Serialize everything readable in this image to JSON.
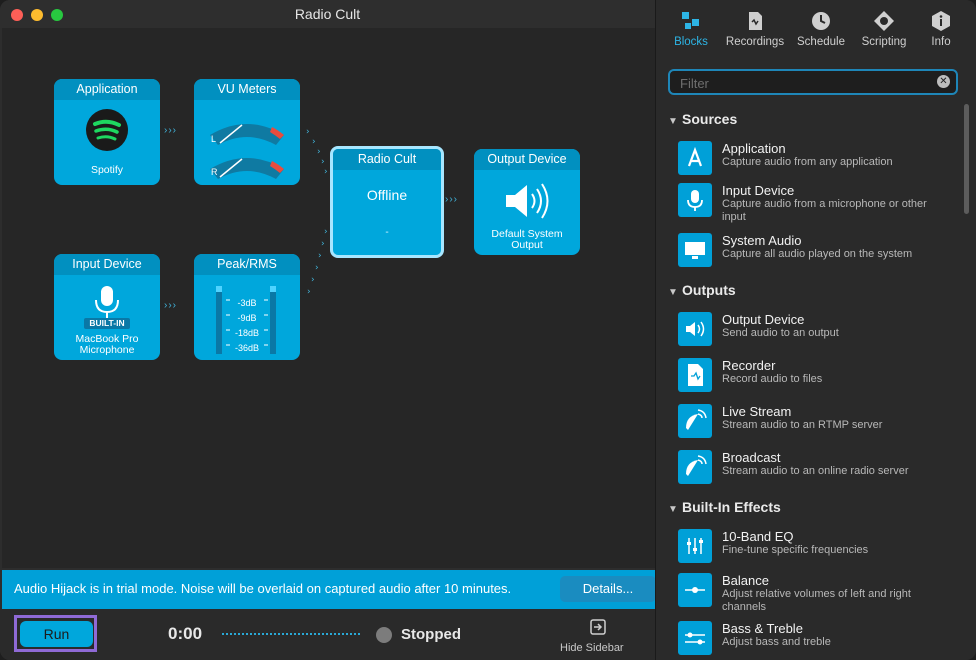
{
  "window": {
    "title": "Radio Cult"
  },
  "blocks": {
    "application": {
      "title": "Application",
      "caption": "Spotify"
    },
    "vu": {
      "title": "VU Meters",
      "l": "L",
      "r": "R"
    },
    "radio": {
      "title": "Radio Cult",
      "status": "Offline",
      "sub": "-"
    },
    "output": {
      "title": "Output Device",
      "caption1": "Default System",
      "caption2": "Output"
    },
    "input": {
      "title": "Input Device",
      "badge": "BUILT-IN",
      "caption1": "MacBook Pro",
      "caption2": "Microphone"
    },
    "peak": {
      "title": "Peak/RMS",
      "levels": [
        "-3dB",
        "-9dB",
        "-18dB",
        "-36dB"
      ]
    }
  },
  "trial": {
    "message": "Audio Hijack is in trial mode. Noise will be overlaid on captured audio after 10 minutes.",
    "details_label": "Details..."
  },
  "bottom": {
    "run_label": "Run",
    "time": "0:00",
    "status": "Stopped",
    "hide_sidebar": "Hide Sidebar"
  },
  "sidebar": {
    "tabs": [
      {
        "label": "Blocks",
        "icon": "blocks-icon"
      },
      {
        "label": "Recordings",
        "icon": "recordings-icon"
      },
      {
        "label": "Schedule",
        "icon": "schedule-icon"
      },
      {
        "label": "Scripting",
        "icon": "scripting-icon"
      },
      {
        "label": "Info",
        "icon": "info-icon"
      }
    ],
    "filter_placeholder": "Filter",
    "sections": [
      {
        "title": "Sources",
        "items": [
          {
            "name": "Application",
            "desc": "Capture audio from any application",
            "icon": "app-store-icon"
          },
          {
            "name": "Input Device",
            "desc": "Capture audio from a microphone or other input",
            "icon": "microphone-icon"
          },
          {
            "name": "System Audio",
            "desc": "Capture all audio played on the system",
            "icon": "monitor-icon"
          }
        ]
      },
      {
        "title": "Outputs",
        "items": [
          {
            "name": "Output Device",
            "desc": "Send audio to an output",
            "icon": "speaker-icon"
          },
          {
            "name": "Recorder",
            "desc": "Record audio to files",
            "icon": "file-icon"
          },
          {
            "name": "Live Stream",
            "desc": "Stream audio to an RTMP server",
            "icon": "satellite-icon"
          },
          {
            "name": "Broadcast",
            "desc": "Stream audio to an online radio server",
            "icon": "broadcast-icon"
          }
        ]
      },
      {
        "title": "Built-In Effects",
        "items": [
          {
            "name": "10-Band EQ",
            "desc": "Fine-tune specific frequencies",
            "icon": "eq-icon"
          },
          {
            "name": "Balance",
            "desc": "Adjust relative volumes of left and right channels",
            "icon": "balance-icon"
          },
          {
            "name": "Bass & Treble",
            "desc": "Adjust bass and treble",
            "icon": "bass-treble-icon"
          }
        ]
      }
    ]
  },
  "colors": {
    "accent": "#00a7dc",
    "header": "#0190c0",
    "trial": "#00a0d8",
    "run_frame": "#8f6ad6"
  }
}
